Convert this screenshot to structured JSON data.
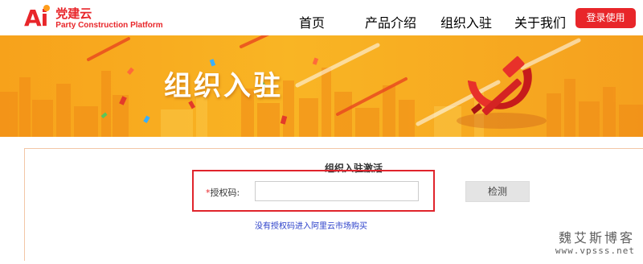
{
  "brand": {
    "logo_mark": "Ai",
    "name_cn": "党建云",
    "name_en": "Party Construction Platform",
    "accent_color": "#e8262a"
  },
  "nav": {
    "items": [
      {
        "label": "首页"
      },
      {
        "label": "产品介绍"
      },
      {
        "label": "组织入驻"
      },
      {
        "label": "关于我们"
      }
    ],
    "login_label": "登录使用"
  },
  "banner": {
    "title": "组织入驻",
    "emblem_icon": "hammer-sickle-icon",
    "background_color": "#f9b524"
  },
  "form": {
    "title": "组织入驻激活",
    "required_mark": "*",
    "code_label": "授权码:",
    "code_value": "",
    "check_label": "检测",
    "buy_link": "没有授权码进入阿里云市场购买"
  },
  "watermark": {
    "text": "魏艾斯博客",
    "url": "www.vpsss.net"
  }
}
